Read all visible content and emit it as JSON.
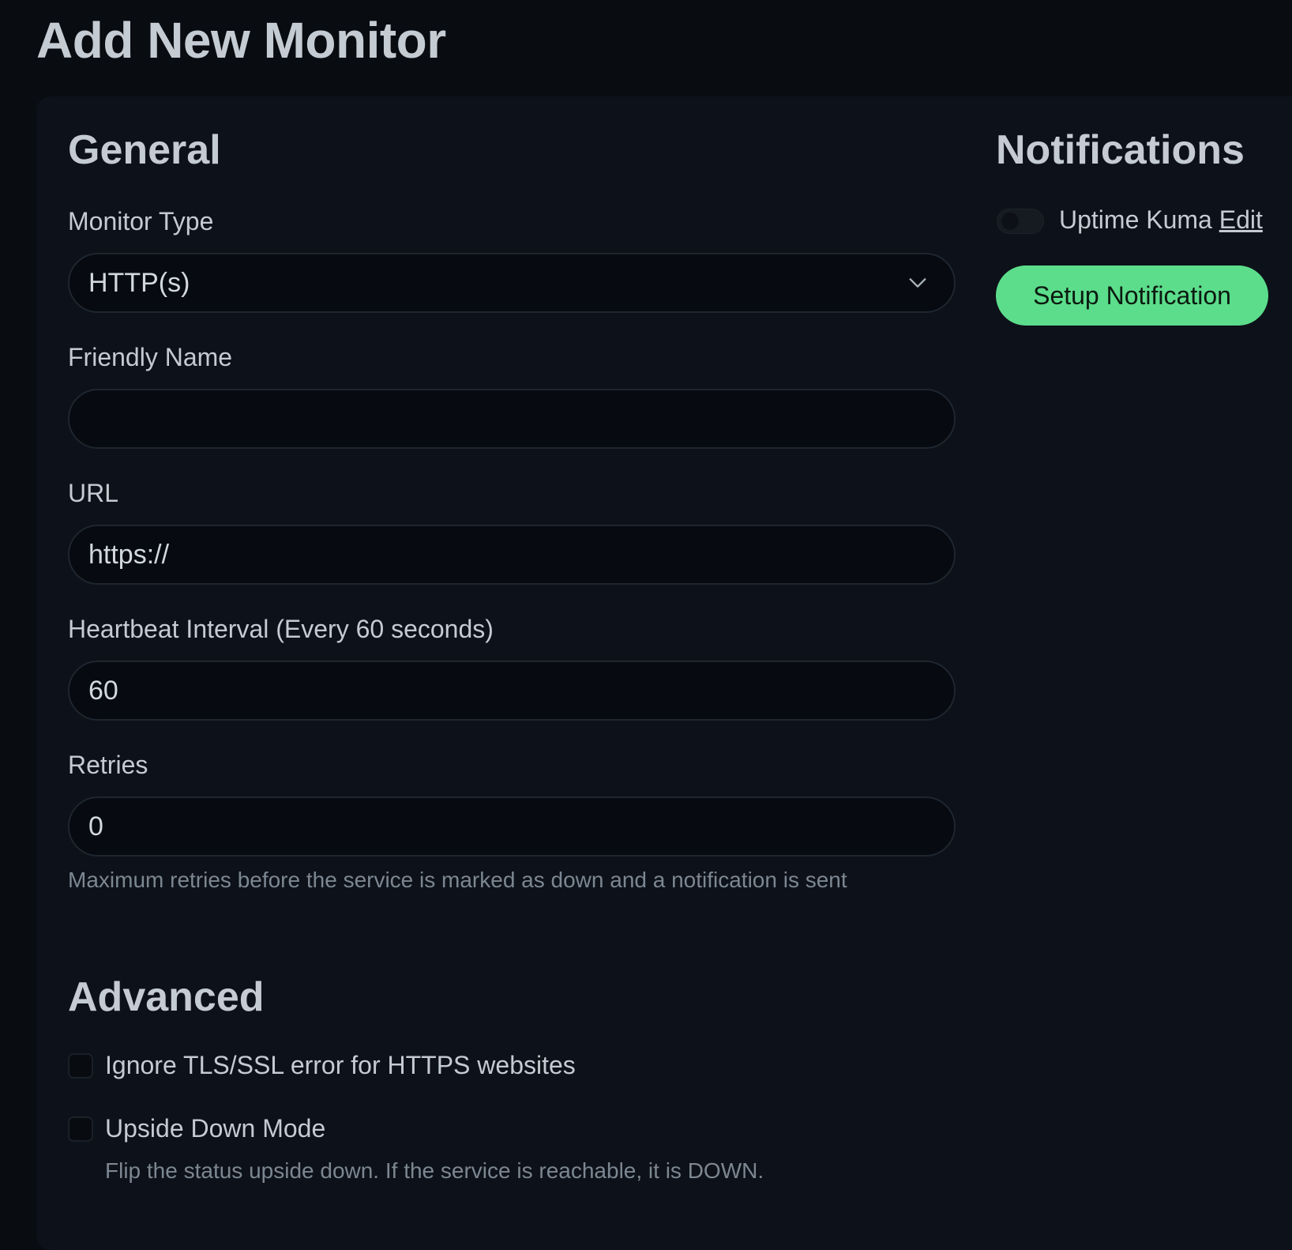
{
  "page": {
    "title": "Add New Monitor"
  },
  "general": {
    "title": "General",
    "monitor_type": {
      "label": "Monitor Type",
      "value": "HTTP(s)"
    },
    "friendly_name": {
      "label": "Friendly Name",
      "value": ""
    },
    "url": {
      "label": "URL",
      "value": "https://"
    },
    "heartbeat": {
      "label": "Heartbeat Interval (Every 60 seconds)",
      "value": "60"
    },
    "retries": {
      "label": "Retries",
      "value": "0",
      "help": "Maximum retries before the service is marked as down and a notification is sent"
    }
  },
  "advanced": {
    "title": "Advanced",
    "ignore_tls": {
      "label": "Ignore TLS/SSL error for HTTPS websites",
      "checked": false
    },
    "upside_down": {
      "label": "Upside Down Mode",
      "checked": false,
      "help": "Flip the status upside down. If the service is reachable, it is DOWN."
    }
  },
  "notifications": {
    "title": "Notifications",
    "items": [
      {
        "name": "Uptime Kuma",
        "edit_label": "Edit",
        "enabled": false
      }
    ],
    "setup_button": "Setup Notification"
  },
  "colors": {
    "background": "#090c11",
    "card": "#0d1119",
    "accent_green": "#5cdd8b"
  },
  "icons": {
    "monitor_type_dropdown": "chevron-down-icon"
  }
}
